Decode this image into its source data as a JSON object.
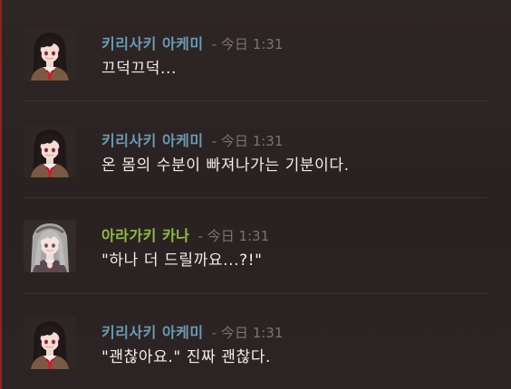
{
  "colors": {
    "author_akemi": "#6a9bb2",
    "author_kana": "#8fbc3f",
    "timestamp": "#7d7272",
    "message": "#f1ecec",
    "accent": "#9a1f1f"
  },
  "messages": [
    {
      "author": "키리사키 아케미",
      "separator": "-",
      "timestamp": "今日 1:31",
      "text": "끄덕끄덕...",
      "avatar_icon": "akemi-avatar-icon"
    },
    {
      "author": "키리사키 아케미",
      "separator": "-",
      "timestamp": "今日 1:31",
      "text": "온 몸의 수분이 빠져나가는 기분이다.",
      "avatar_icon": "akemi-avatar-icon"
    },
    {
      "author": "아라가키 카나",
      "separator": "-",
      "timestamp": "今日 1:31",
      "text": "\"하나 더 드릴까요...?!\"",
      "avatar_icon": "kana-avatar-icon"
    },
    {
      "author": "키리사키 아케미",
      "separator": "-",
      "timestamp": "今日 1:31",
      "text": "\"괜찮아요.\" 진짜 괜찮다.",
      "avatar_icon": "akemi-avatar-icon"
    }
  ]
}
